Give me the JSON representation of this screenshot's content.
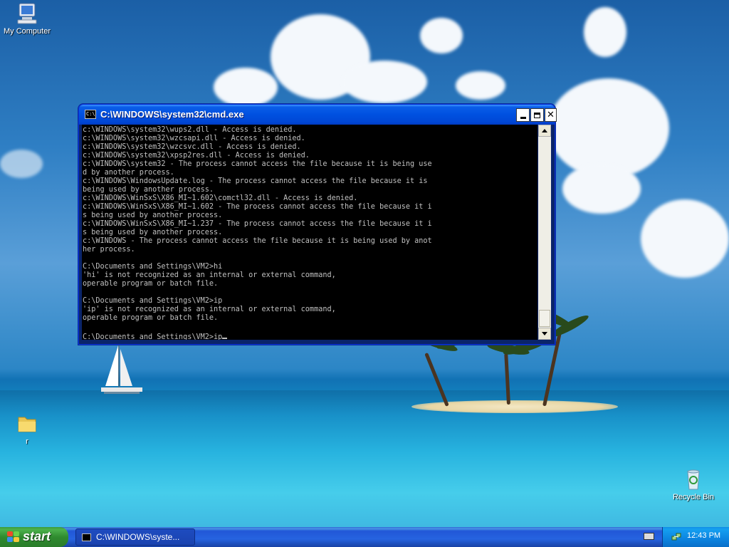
{
  "desktop": {
    "icons": {
      "my_computer": "My Computer",
      "folder": "r",
      "recycle_bin": "Recycle Bin"
    }
  },
  "cmd_window": {
    "title": "C:\\WINDOWS\\system32\\cmd.exe",
    "icon_text": "C:\\",
    "output": "c:\\WINDOWS\\system32\\wups2.dll - Access is denied.\nc:\\WINDOWS\\system32\\wzcsapi.dll - Access is denied.\nc:\\WINDOWS\\system32\\wzcsvc.dll - Access is denied.\nc:\\WINDOWS\\system32\\xpsp2res.dll - Access is denied.\nc:\\WINDOWS\\system32 - The process cannot access the file because it is being use\nd by another process.\nc:\\WINDOWS\\WindowsUpdate.log - The process cannot access the file because it is\nbeing used by another process.\nc:\\WINDOWS\\WinSxS\\X86_MI~1.602\\comctl32.dll - Access is denied.\nc:\\WINDOWS\\WinSxS\\X86_MI~1.602 - The process cannot access the file because it i\ns being used by another process.\nc:\\WINDOWS\\WinSxS\\X86_MI~1.237 - The process cannot access the file because it i\ns being used by another process.\nc:\\WINDOWS - The process cannot access the file because it is being used by anot\nher process.\n\nC:\\Documents and Settings\\VM2>hi\n'hi' is not recognized as an internal or external command,\noperable program or batch file.\n\nC:\\Documents and Settings\\VM2>ip\n'ip' is not recognized as an internal or external command,\noperable program or batch file.\n\n",
    "prompt": "C:\\Documents and Settings\\VM2>",
    "current_input": "ip"
  },
  "taskbar": {
    "start_label": "start",
    "task_button_label": "C:\\WINDOWS\\syste...",
    "clock": "12:43 PM"
  },
  "colors": {
    "titlebar": "#0050e0",
    "console_bg": "#000000",
    "console_text": "#c0c0c0",
    "start_green": "#2f8b2f",
    "taskbar_blue": "#2663e0"
  }
}
